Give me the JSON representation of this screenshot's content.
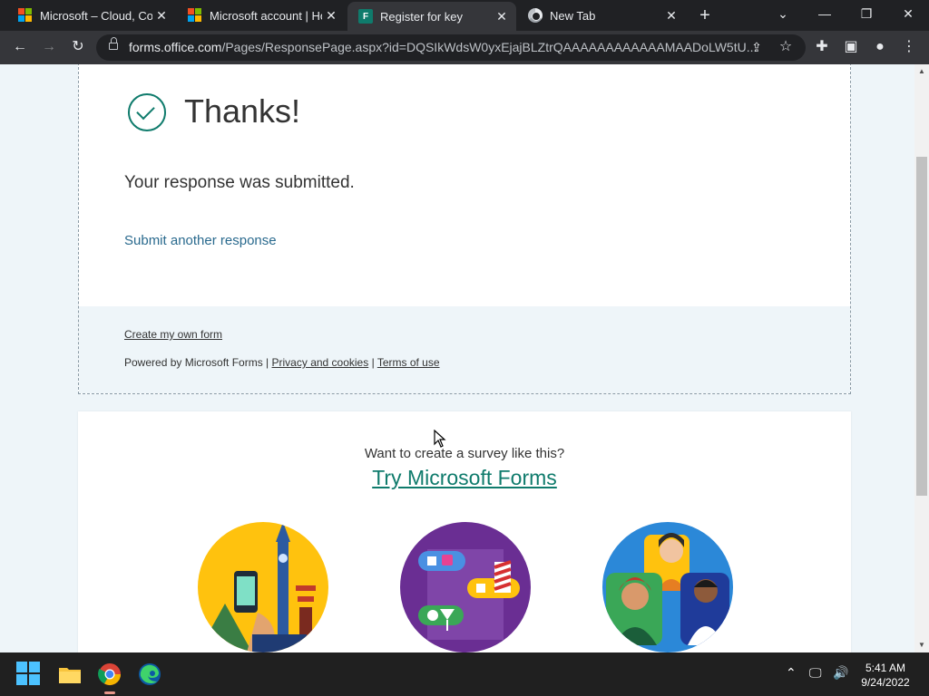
{
  "tabs": [
    {
      "title": "Microsoft – Cloud, Com",
      "favicon": "microsoft-logo-icon",
      "active": false
    },
    {
      "title": "Microsoft account | Hor",
      "favicon": "microsoft-logo-icon",
      "active": false
    },
    {
      "title": "Register for key",
      "favicon": "forms-icon",
      "active": true
    },
    {
      "title": "New Tab",
      "favicon": "chrome-icon",
      "active": false
    }
  ],
  "address": {
    "host": "forms.office.com",
    "path": "/Pages/ResponsePage.aspx?id=DQSIkWdsW0yxEjajBLZtrQAAAAAAAAAAAAMAADoLW5tU..."
  },
  "response": {
    "heading": "Thanks!",
    "message": "Your response was submitted.",
    "another_link": "Submit another response"
  },
  "footer": {
    "create_link": "Create my own form",
    "powered_by": "Powered by Microsoft Forms |",
    "privacy_link": "Privacy and cookies",
    "separator": "|",
    "terms_link": "Terms of use"
  },
  "promo": {
    "question": "Want to create a survey like this?",
    "link": "Try Microsoft Forms"
  },
  "taskbar": {
    "time": "5:41 AM",
    "date": "9/24/2022"
  },
  "colors": {
    "forms_green": "#0f7b6c",
    "link_blue": "#2a6a8e",
    "page_bg": "#eef5f9"
  }
}
